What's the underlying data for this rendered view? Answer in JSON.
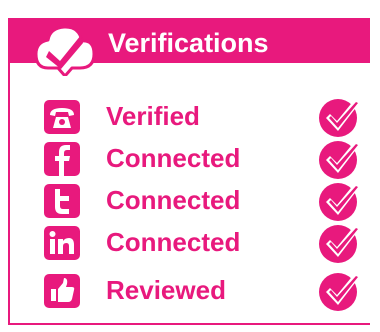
{
  "colors": {
    "accent": "#e8197d",
    "on_accent": "#ffffff"
  },
  "header": {
    "title": "Verifications",
    "badge_icon": "cloud-check-icon"
  },
  "rows": [
    {
      "icon": "phone-icon",
      "label": "Verified",
      "status_icon": "check-badge-icon"
    },
    {
      "icon": "facebook-icon",
      "label": "Connected",
      "status_icon": "check-badge-icon"
    },
    {
      "icon": "twitter-icon",
      "label": "Connected",
      "status_icon": "check-badge-icon"
    },
    {
      "icon": "linkedin-icon",
      "label": "Connected",
      "status_icon": "check-badge-icon"
    },
    {
      "icon": "thumbs-up-icon",
      "label": "Reviewed",
      "status_icon": "check-badge-icon"
    }
  ]
}
